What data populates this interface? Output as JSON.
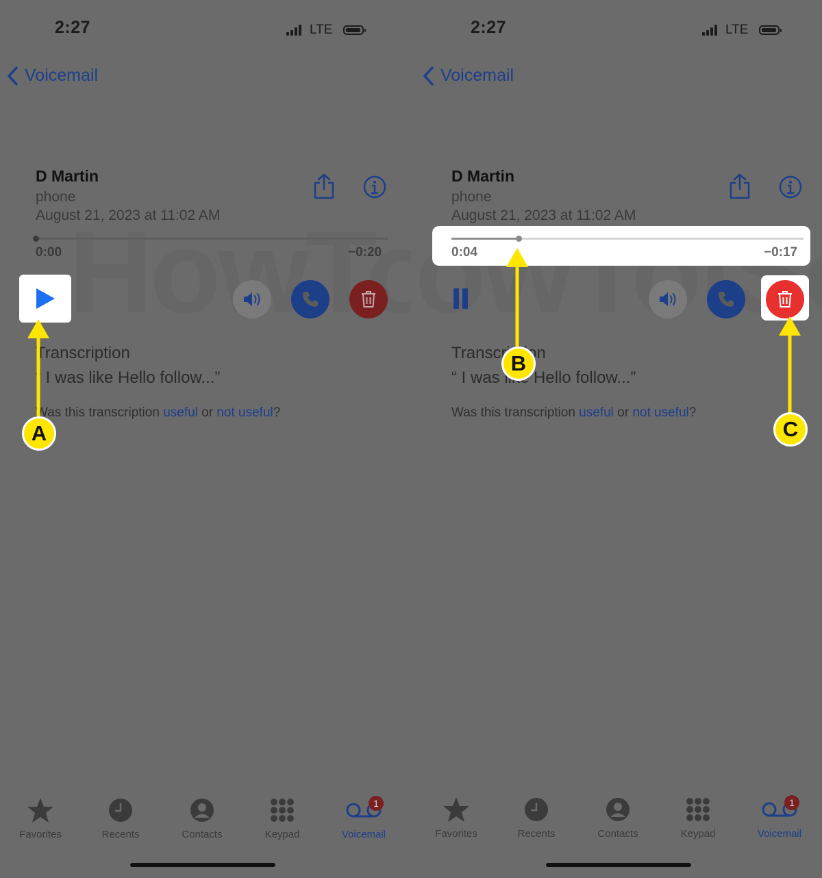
{
  "left": {
    "status": {
      "time": "2:27",
      "network": "LTE"
    },
    "nav": {
      "back_label": "Voicemail"
    },
    "voicemail": {
      "caller": "D Martin",
      "source": "phone",
      "date": "August 21, 2023 at 11:02 AM",
      "elapsed": "0:00",
      "remaining": "−0:20",
      "progress_fraction": 0.0
    },
    "transcription": {
      "title": "Transcription",
      "text": "“ I was like Hello follow...”",
      "question_prefix": "Was this transcription ",
      "useful": "useful",
      "or": " or ",
      "not_useful": "not useful",
      "question_suffix": "?"
    },
    "callout": "A"
  },
  "right": {
    "status": {
      "time": "2:27",
      "network": "LTE"
    },
    "nav": {
      "back_label": "Voicemail"
    },
    "voicemail": {
      "caller": "D Martin",
      "source": "phone",
      "date": "August 21, 2023 at 11:02 AM",
      "elapsed": "0:04",
      "remaining": "−0:17",
      "progress_fraction": 0.19
    },
    "transcription": {
      "title": "Transcription",
      "text": "“ I was like Hello follow...”",
      "question_prefix": "Was this transcription ",
      "useful": "useful",
      "or": " or ",
      "not_useful": "not useful",
      "question_suffix": "?"
    },
    "callouts": [
      "B",
      "C"
    ]
  },
  "tabbar": {
    "items": [
      {
        "label": "Favorites",
        "icon": "star-icon"
      },
      {
        "label": "Recents",
        "icon": "clock-icon"
      },
      {
        "label": "Contacts",
        "icon": "person-icon"
      },
      {
        "label": "Keypad",
        "icon": "keypad-icon"
      },
      {
        "label": "Voicemail",
        "icon": "voicemail-icon"
      }
    ],
    "voicemail_badge": "1",
    "active": "Voicemail"
  },
  "watermark": "HowToiSolve.com",
  "colors": {
    "accent": "#1d3f8a",
    "callout": "#ffe600",
    "delete": "#e8302e"
  }
}
